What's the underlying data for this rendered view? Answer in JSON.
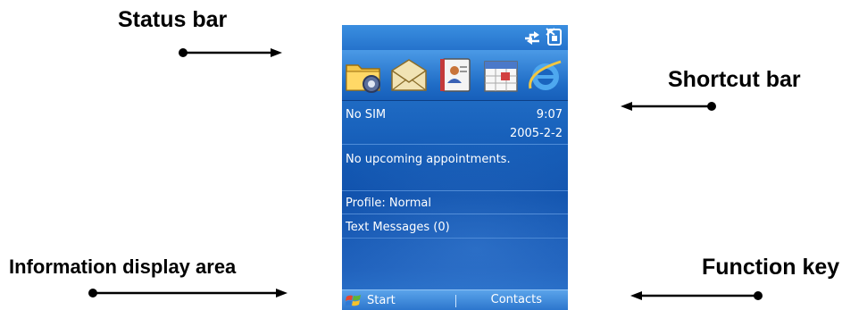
{
  "callouts": {
    "status_bar": "Status bar",
    "shortcut_bar": "Shortcut bar",
    "information_area": "Information display area",
    "function_key": "Function key"
  },
  "screen": {
    "status_icons": [
      "connection-icon",
      "no-sim-icon"
    ],
    "shortcuts": [
      "settings-folder-icon",
      "messaging-envelope-icon",
      "contacts-card-icon",
      "calendar-icon",
      "internet-explorer-icon"
    ],
    "carrier": "No SIM",
    "time": "9:07",
    "date": "2005-2-2",
    "appointments": "No upcoming appointments.",
    "profile": "Profile: Normal",
    "messages": "Text Messages (0)",
    "softkeys": {
      "left": "Start",
      "right": "Contacts"
    }
  },
  "colors": {
    "screen_blue": "#1a64be",
    "callout_text": "#000000"
  }
}
